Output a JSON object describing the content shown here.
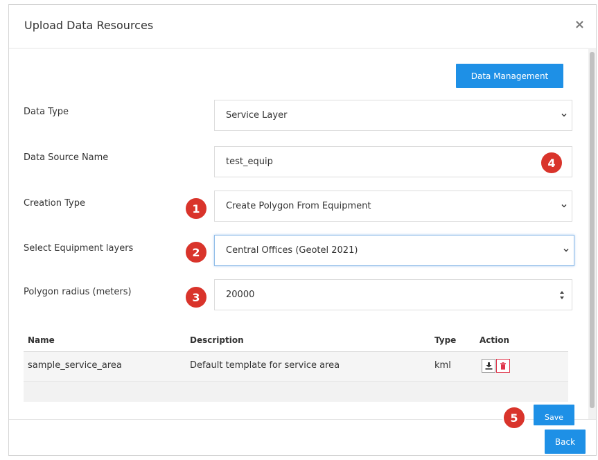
{
  "dialog": {
    "title": "Upload Data Resources",
    "close_label": "×"
  },
  "toolbar": {
    "data_management_label": "Data Management"
  },
  "form": {
    "data_type": {
      "label": "Data Type",
      "value": "Service Layer"
    },
    "data_source_name": {
      "label": "Data Source Name",
      "value": "test_equip"
    },
    "creation_type": {
      "label": "Creation Type",
      "value": "Create Polygon From Equipment"
    },
    "equipment_layers": {
      "label": "Select Equipment layers",
      "value": "Central Offices (Geotel 2021)"
    },
    "polygon_radius": {
      "label": "Polygon radius (meters)",
      "value": "20000"
    }
  },
  "table": {
    "headers": {
      "name": "Name",
      "description": "Description",
      "type": "Type",
      "action": "Action"
    },
    "rows": [
      {
        "name": "sample_service_area",
        "description": "Default template for service area",
        "type": "kml"
      }
    ]
  },
  "footer": {
    "save_label": "Save",
    "back_label": "Back"
  },
  "badges": [
    "1",
    "2",
    "3",
    "4",
    "5"
  ],
  "colors": {
    "primary": "#1e90e6",
    "badge": "#d9342b",
    "delete": "#e0344a"
  },
  "icons": {
    "close": "close-icon",
    "chevron": "chevron-down-icon",
    "spinner": "spinner-arrows-icon",
    "download": "download-icon",
    "delete": "trash-icon"
  }
}
